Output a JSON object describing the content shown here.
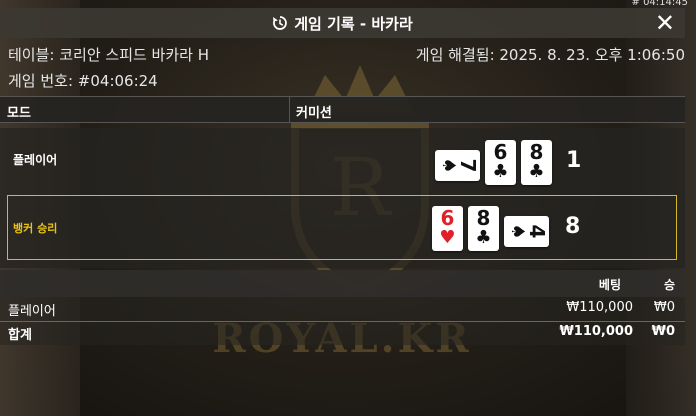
{
  "corner_time": "# 04:14:45",
  "header": {
    "title": "게임 기록 - 바카라",
    "history_icon": "history-icon",
    "close_icon": "close-icon"
  },
  "info": {
    "table": "테이블: 코리안 스피드 바카라 H",
    "resolved": "게임 해결됨: 2025. 8. 23. 오후 1:06:50",
    "game_number": "게임 번호: #04:06:24"
  },
  "columns": {
    "mode": "모드",
    "commission": "커미션"
  },
  "result": {
    "player": {
      "label": "플레이어",
      "score": "1",
      "cards": [
        {
          "rank": "7",
          "suit": "♠",
          "color": "#111111",
          "sideways": true
        },
        {
          "rank": "6",
          "suit": "♣",
          "color": "#111111",
          "sideways": false
        },
        {
          "rank": "8",
          "suit": "♣",
          "color": "#111111",
          "sideways": false
        }
      ]
    },
    "banker": {
      "label": "뱅커 승리",
      "label_color": "#e8c21a",
      "score": "8",
      "cards": [
        {
          "rank": "6",
          "suit": "♥",
          "color": "#e0202a",
          "sideways": false
        },
        {
          "rank": "8",
          "suit": "♣",
          "color": "#111111",
          "sideways": false
        },
        {
          "rank": "4",
          "suit": "♠",
          "color": "#111111",
          "sideways": true
        }
      ]
    }
  },
  "bets": {
    "col_bet": "베팅",
    "col_win": "승",
    "rows": [
      {
        "name": "플레이어",
        "bet": "₩110,000",
        "win": "₩0"
      }
    ],
    "total": {
      "name": "합계",
      "bet": "₩110,000",
      "win": "₩0"
    }
  },
  "watermark": "ROYAL.KR",
  "colors": {
    "header_bg": "#3c3832",
    "winner_border": "#d4b829",
    "banker_label": "#e8c21a"
  }
}
